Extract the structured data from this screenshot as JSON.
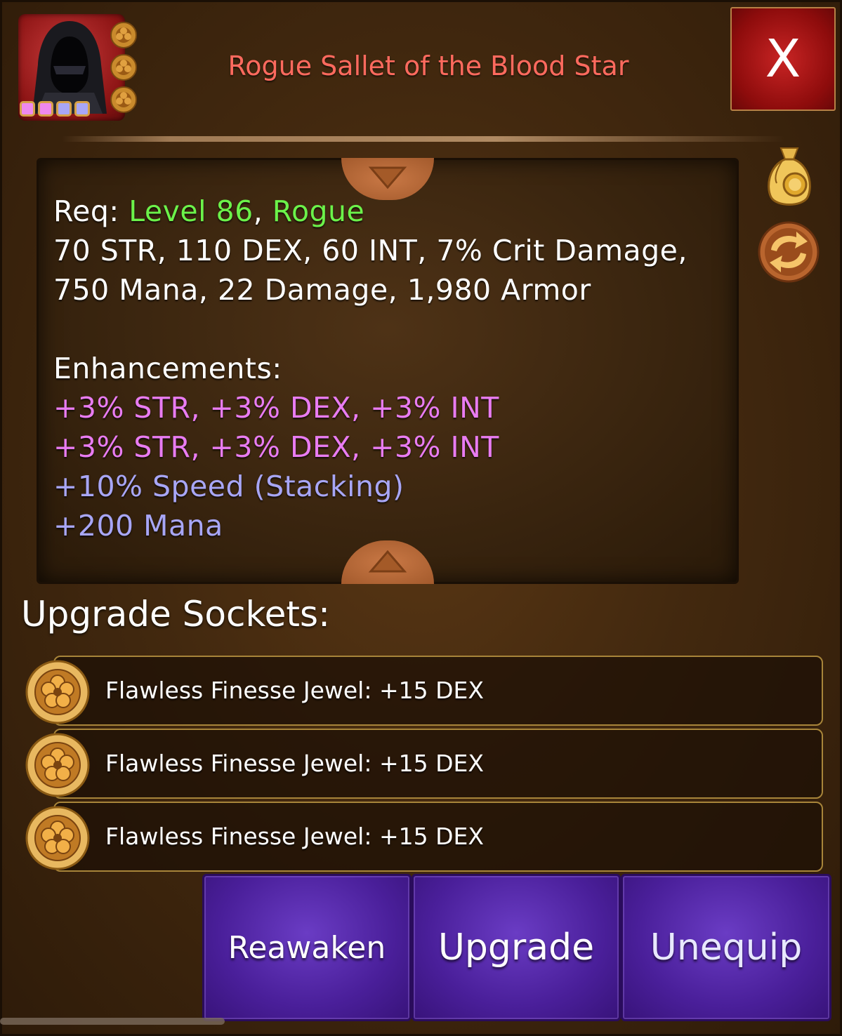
{
  "item": {
    "title": "Rogue Sallet of the Blood Star",
    "gem_dot_colors": [
      "#ee88ee",
      "#ee88ee",
      "#a8a6f6",
      "#a8a6f6"
    ]
  },
  "header": {
    "close_label": "X"
  },
  "stats": {
    "req_label": "Req:",
    "req_level": "Level 86",
    "req_sep": ",",
    "req_class": "Rogue",
    "line2": "70 STR, 110 DEX, 60 INT, 7% Crit Damage,",
    "line3": "750 Mana, 22 Damage, 1,980 Armor",
    "enh_title": "Enhancements:",
    "enhancements": [
      "+3% STR, +3% DEX, +3% INT",
      "+3% STR, +3% DEX, +3% INT",
      "+10% Speed (Stacking)",
      "+200 Mana"
    ]
  },
  "sockets": {
    "title": "Upgrade Sockets:",
    "items": [
      {
        "label": "Flawless Finesse Jewel: +15 DEX"
      },
      {
        "label": "Flawless Finesse Jewel: +15 DEX"
      },
      {
        "label": "Flawless Finesse Jewel: +15 DEX"
      }
    ]
  },
  "buttons": {
    "reawaken": "Reawaken",
    "upgrade": "Upgrade",
    "unequip": "Unequip"
  },
  "icons": {
    "portrait": "hooded-rogue-icon",
    "bag": "coin-bag-icon",
    "swap": "swap-arrows-icon",
    "jewel": "finesse-jewel-icon"
  }
}
